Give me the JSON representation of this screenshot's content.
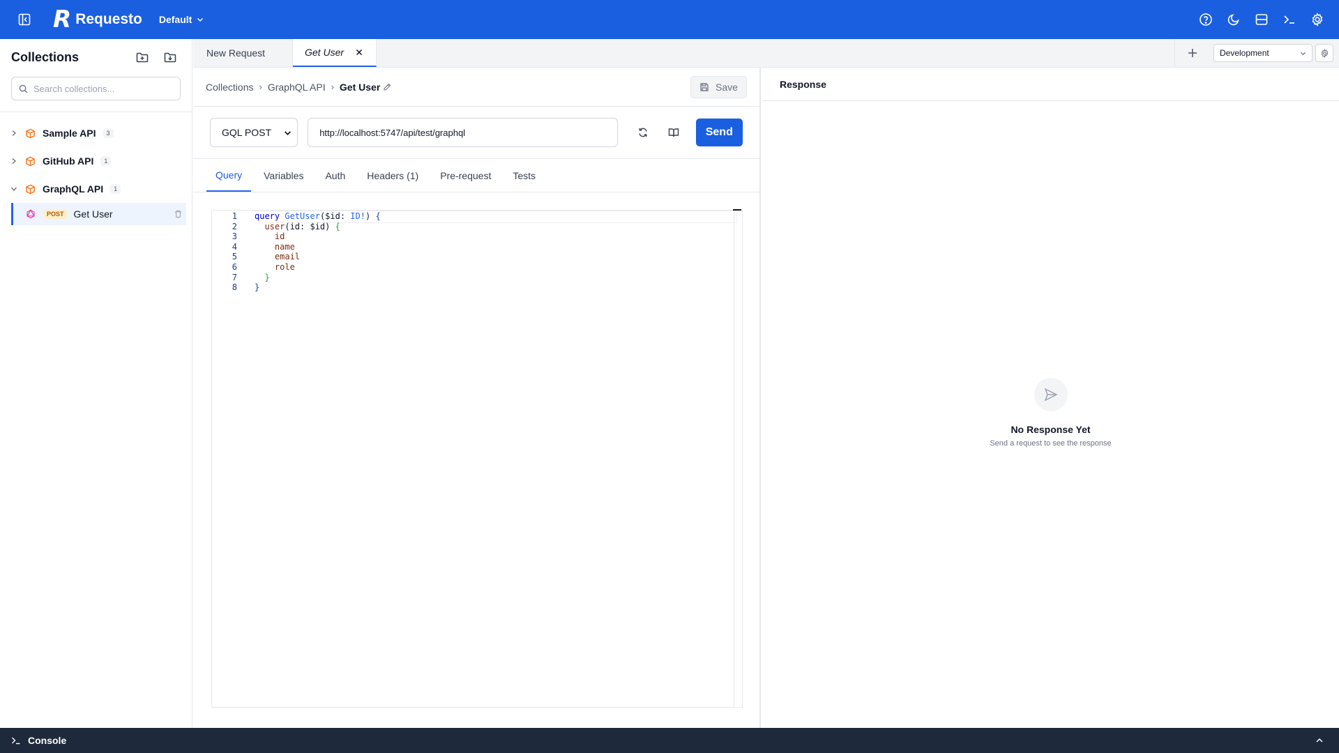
{
  "app": {
    "logo_mark": "R",
    "name": "Requesto",
    "workspace": "Default",
    "accent_color": "#1a5fe0"
  },
  "topbar_icons": [
    "help-icon",
    "moon-icon",
    "layout-icon",
    "terminal-icon",
    "gear-icon"
  ],
  "sidebar": {
    "title": "Collections",
    "search_placeholder": "Search collections...",
    "collections": [
      {
        "name": "Sample API",
        "count": "3",
        "expanded": false
      },
      {
        "name": "GitHub API",
        "count": "1",
        "expanded": false
      },
      {
        "name": "GraphQL API",
        "count": "1",
        "expanded": true
      }
    ],
    "requests": [
      {
        "method": "POST",
        "name": "Get User"
      }
    ]
  },
  "tabs": [
    {
      "label": "New Request",
      "active": false
    },
    {
      "label": "Get User",
      "active": true
    }
  ],
  "environment": {
    "selected": "Development"
  },
  "breadcrumb": {
    "items": [
      "Collections",
      "GraphQL API"
    ],
    "separator": "›",
    "current": "Get User"
  },
  "request": {
    "save_label": "Save",
    "method": "GQL POST",
    "url": "http://localhost:5747/api/test/graphql",
    "send_label": "Send",
    "sub_tabs": [
      "Query",
      "Variables",
      "Auth",
      "Headers (1)",
      "Pre-request",
      "Tests"
    ],
    "active_sub_tab": "Query"
  },
  "editor": {
    "line_numbers": [
      "1",
      "2",
      "3",
      "4",
      "5",
      "6",
      "7",
      "8"
    ],
    "lines": [
      "query GetUser($id: ID!) {",
      "  user(id: $id) {",
      "    id",
      "    name",
      "    email",
      "    role",
      "  }",
      "}"
    ]
  },
  "response": {
    "title": "Response",
    "empty_title": "No Response Yet",
    "empty_subtitle": "Send a request to see the response"
  },
  "console": {
    "label": "Console"
  }
}
